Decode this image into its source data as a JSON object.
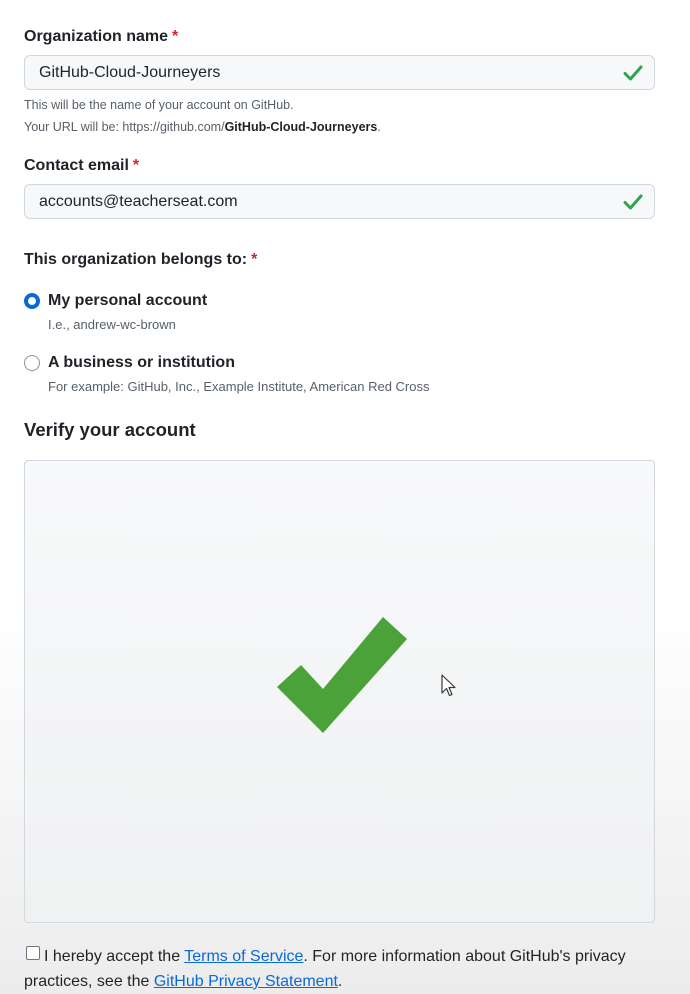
{
  "org_name": {
    "label": "Organization name",
    "required": "*",
    "value": "GitHub-Cloud-Journeyers",
    "hint_line1": "This will be the name of your account on GitHub.",
    "hint_line2_prefix": "Your URL will be: https://github.com/",
    "hint_line2_bold": "GitHub-Cloud-Journeyers",
    "hint_line2_suffix": "."
  },
  "contact_email": {
    "label": "Contact email",
    "required": "*",
    "value": "accounts@teacherseat.com"
  },
  "belongs_to": {
    "label": "This organization belongs to:",
    "required": "*",
    "options": [
      {
        "title": "My personal account",
        "subtitle": "I.e., andrew-wc-brown",
        "checked": true
      },
      {
        "title": "A business or institution",
        "subtitle": "For example: GitHub, Inc., Example Institute, American Red Cross",
        "checked": false
      }
    ]
  },
  "verify": {
    "heading": "Verify your account",
    "status_icon": "checkmark-icon",
    "check_color": "#4ba238"
  },
  "tos": {
    "text_before": "I hereby accept the ",
    "terms_link": "Terms of Service",
    "text_middle": ". For more information about GitHub's privacy practices, see the ",
    "privacy_link": "GitHub Privacy Statement",
    "text_after": ".",
    "checked": false
  },
  "colors": {
    "valid_check": "#2da44e",
    "required": "#cf222e",
    "link": "#0969da",
    "radio_selected": "#0969da"
  }
}
